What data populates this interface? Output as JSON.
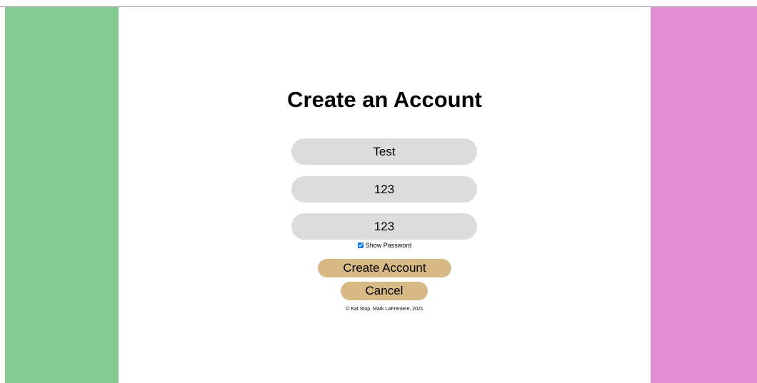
{
  "colors": {
    "left_panel": "#82cc93",
    "right_panel": "#e48ed2",
    "field_bg": "#dcdcdc",
    "button_bg": "#d7b986"
  },
  "form": {
    "title": "Create an Account",
    "username_value": "Test",
    "password_value": "123",
    "confirm_password_value": "123",
    "show_password_label": "Show Password",
    "show_password_checked": true,
    "create_button_label": "Create Account",
    "cancel_button_label": "Cancel"
  },
  "footer": {
    "copyright": "© Kat Stop, Mark LaFreniere, 2021"
  }
}
